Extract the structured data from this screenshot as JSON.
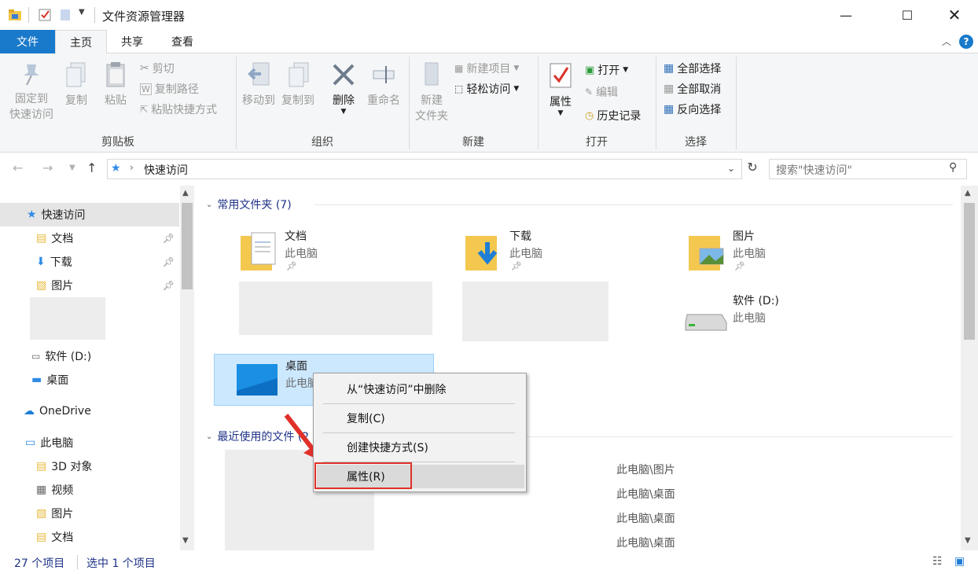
{
  "window": {
    "title": "文件资源管理器"
  },
  "tabs": {
    "file": "文件",
    "home": "主页",
    "share": "共享",
    "view": "查看"
  },
  "ribbon": {
    "clipboard": {
      "label": "剪贴板",
      "pin_line1": "固定到",
      "pin_line2": "快速访问",
      "copy": "复制",
      "paste": "粘贴",
      "cut": "剪切",
      "copy_path": "复制路径",
      "paste_shortcut": "粘贴快捷方式"
    },
    "organize": {
      "label": "组织",
      "move_to": "移动到",
      "copy_to": "复制到",
      "delete": "删除",
      "rename": "重命名"
    },
    "new": {
      "label": "新建",
      "new_folder_line1": "新建",
      "new_folder_line2": "文件夹",
      "new_item": "新建项目",
      "easy_access": "轻松访问"
    },
    "open": {
      "label": "打开",
      "properties": "属性",
      "open": "打开",
      "edit": "编辑",
      "history": "历史记录"
    },
    "select": {
      "label": "选择",
      "select_all": "全部选择",
      "select_none": "全部取消",
      "invert": "反向选择"
    }
  },
  "address": {
    "location": "快速访问",
    "search_placeholder": "搜索\"快速访问\""
  },
  "nav": {
    "quick_access": "快速访问",
    "documents": "文档",
    "downloads": "下载",
    "pictures": "图片",
    "drive_d": "软件 (D:)",
    "desktop": "桌面",
    "onedrive": "OneDrive",
    "this_pc": "此电脑",
    "objects3d": "3D 对象",
    "videos": "视频",
    "pictures2": "图片",
    "documents2": "文档"
  },
  "content": {
    "frequent_header": "常用文件夹 (7)",
    "recent_header": "最近使用的文件 (2",
    "tiles": {
      "documents": {
        "name": "文档",
        "sub": "此电脑"
      },
      "downloads": {
        "name": "下载",
        "sub": "此电脑"
      },
      "pictures": {
        "name": "图片",
        "sub": "此电脑"
      },
      "drive_d": {
        "name": "软件 (D:)",
        "sub": "此电脑"
      },
      "desktop": {
        "name": "桌面",
        "sub": "此电脑"
      }
    },
    "recent_paths": [
      "此电脑\\图片",
      "此电脑\\桌面",
      "此电脑\\桌面",
      "此电脑\\桌面"
    ]
  },
  "context_menu": {
    "remove": "从“快速访问”中删除",
    "copy": "复制(C)",
    "shortcut": "创建快捷方式(S)",
    "properties": "属性(R)"
  },
  "status": {
    "count": "27 个项目",
    "selected": "选中 1 个项目"
  },
  "colors": {
    "accent": "#1979ca",
    "highlight_border": "#e0302a",
    "selection": "#cce8ff"
  }
}
